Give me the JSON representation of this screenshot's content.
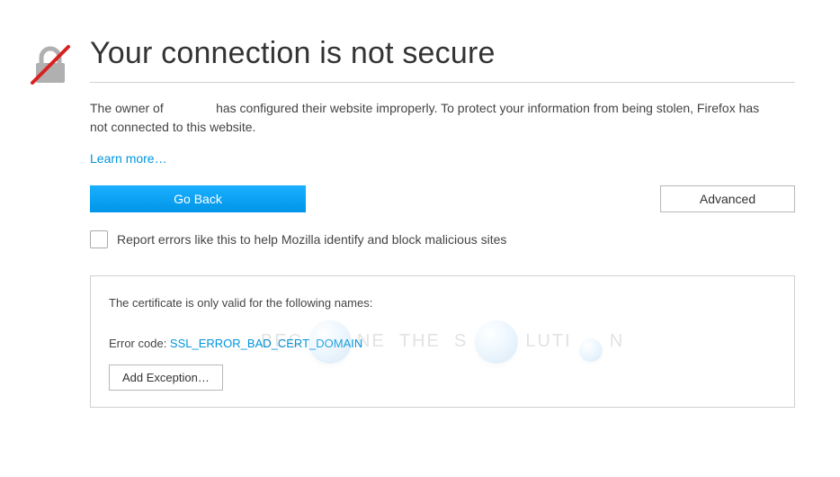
{
  "title": "Your connection is not secure",
  "description_prefix": "The owner of ",
  "description_suffix": " has configured their website improperly. To protect your information from being stolen, Firefox has not connected to this website.",
  "learn_more": "Learn more…",
  "buttons": {
    "go_back": "Go Back",
    "advanced": "Advanced",
    "add_exception": "Add Exception…"
  },
  "report_label": "Report errors like this to help Mozilla identify and block malicious sites",
  "cert_panel": {
    "valid_for_text": "The certificate is only valid for the following names:",
    "error_code_label": "Error code: ",
    "error_code": "SSL_ERROR_BAD_CERT_DOMAIN"
  }
}
